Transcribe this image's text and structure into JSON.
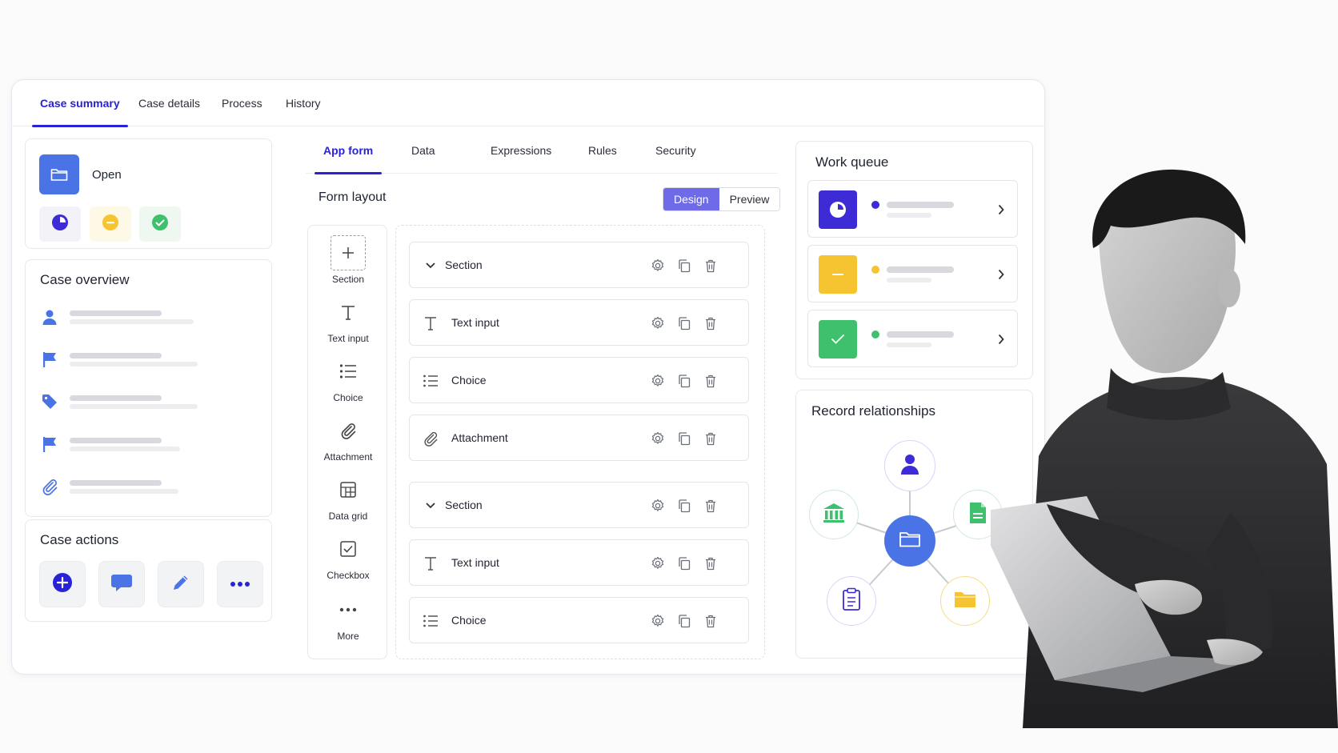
{
  "top_tabs": [
    "Case summary",
    "Case details",
    "Process",
    "History"
  ],
  "status": {
    "label": "Open",
    "chips": [
      "clock-icon",
      "minus-circle-icon",
      "check-circle-icon"
    ]
  },
  "case_overview": {
    "title": "Case overview",
    "rows": [
      "person-icon",
      "flag-icon",
      "tag-icon",
      "flag-icon",
      "paperclip-icon"
    ]
  },
  "case_actions": {
    "title": "Case actions",
    "buttons": [
      "plus-icon",
      "chat-icon",
      "pencil-icon",
      "more-icon"
    ]
  },
  "form_tabs": [
    "App form",
    "Data",
    "Expressions",
    "Rules",
    "Security"
  ],
  "form_layout": {
    "title": "Form layout",
    "toggle": {
      "design": "Design",
      "preview": "Preview"
    }
  },
  "palette": [
    {
      "icon": "plus-icon",
      "label": "Section"
    },
    {
      "icon": "text-icon",
      "label": "Text input"
    },
    {
      "icon": "list-icon",
      "label": "Choice"
    },
    {
      "icon": "paperclip-icon",
      "label": "Attachment"
    },
    {
      "icon": "grid-icon",
      "label": "Data grid"
    },
    {
      "icon": "checkbox-icon",
      "label": "Checkbox"
    },
    {
      "icon": "more-icon",
      "label": "More"
    }
  ],
  "fields": [
    {
      "type": "section",
      "label": "Section"
    },
    {
      "type": "text",
      "label": "Text input"
    },
    {
      "type": "choice",
      "label": "Choice"
    },
    {
      "type": "attachment",
      "label": "Attachment"
    },
    {
      "type": "section",
      "label": "Section"
    },
    {
      "type": "text",
      "label": "Text input"
    },
    {
      "type": "choice",
      "label": "Choice"
    }
  ],
  "work_queue": {
    "title": "Work queue",
    "items": [
      {
        "icon": "clock-icon",
        "color": "#3d2bd6"
      },
      {
        "icon": "minus-icon",
        "color": "#f6c431"
      },
      {
        "icon": "check-icon",
        "color": "#3ec06c"
      }
    ]
  },
  "record_relationships": {
    "title": "Record relationships"
  },
  "colors": {
    "accent": "#2a22d6",
    "design_toggle": "#6f6ae8",
    "folder_blue": "#4a74e6",
    "yellow": "#f6c431",
    "green": "#3ec06c"
  }
}
